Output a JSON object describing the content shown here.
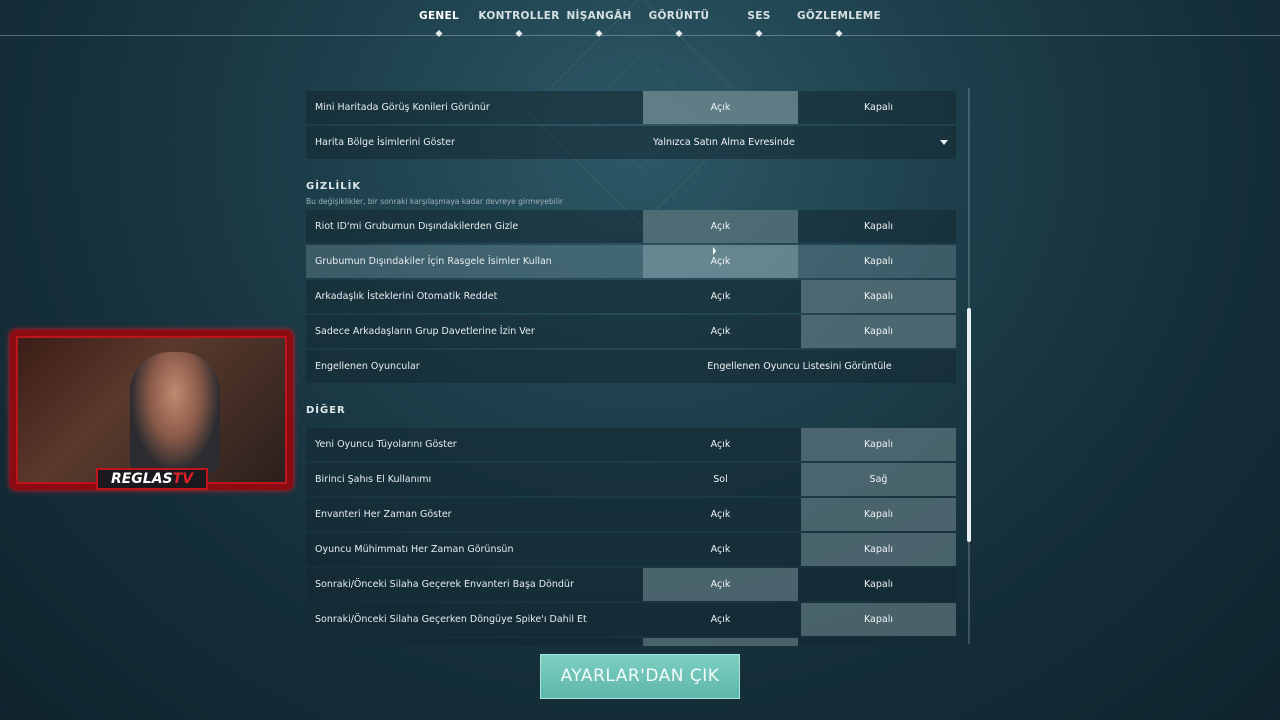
{
  "nav": {
    "tabs": [
      {
        "label": "GENEL",
        "active": true
      },
      {
        "label": "KONTROLLER",
        "active": false
      },
      {
        "label": "NİŞANGÂH",
        "active": false
      },
      {
        "label": "GÖRÜNTÜ",
        "active": false
      },
      {
        "label": "SES",
        "active": false
      },
      {
        "label": "GÖZLEMLEME",
        "active": false
      }
    ]
  },
  "map_rows": [
    {
      "label": "Mini Haritada Görüş Konileri Görünür",
      "opt_a": "Açık",
      "opt_b": "Kapalı",
      "selected": "a"
    },
    {
      "label": "Harita Bölge İsimlerini Göster",
      "dropdown_value": "Yalnızca Satın Alma Evresinde"
    }
  ],
  "privacy": {
    "title": "GİZLİLİK",
    "subtitle": "Bu değişiklikler, bir sonraki karşılaşmaya kadar devreye girmeyebilir",
    "rows": [
      {
        "label": "Riot ID'mi Grubumun Dışındakilerden Gizle",
        "opt_a": "Açık",
        "opt_b": "Kapalı",
        "selected": "a"
      },
      {
        "label": "Grubumun Dışındakiler İçin Rasgele İsimler Kullan",
        "opt_a": "Açık",
        "opt_b": "Kapalı",
        "selected": "a"
      },
      {
        "label": "Arkadaşlık İsteklerini Otomatik Reddet",
        "opt_a": "Açık",
        "opt_b": "Kapalı",
        "selected": "b"
      },
      {
        "label": "Sadece Arkadaşların Grup Davetlerine İzin Ver",
        "opt_a": "Açık",
        "opt_b": "Kapalı",
        "selected": "b"
      }
    ],
    "blocked_label": "Engellenen Oyuncular",
    "blocked_button": "Engellenen Oyuncu Listesini Görüntüle"
  },
  "other": {
    "title": "DİĞER",
    "rows": [
      {
        "label": "Yeni Oyuncu Tüyolarını Göster",
        "opt_a": "Açık",
        "opt_b": "Kapalı",
        "selected": "b"
      },
      {
        "label": "Birinci Şahıs El Kullanımı",
        "opt_a": "Sol",
        "opt_b": "Sağ",
        "selected": "b"
      },
      {
        "label": "Envanteri Her Zaman Göster",
        "opt_a": "Açık",
        "opt_b": "Kapalı",
        "selected": "b"
      },
      {
        "label": "Oyuncu Mühimmatı Her Zaman Görünsün",
        "opt_a": "Açık",
        "opt_b": "Kapalı",
        "selected": "b"
      },
      {
        "label": "Sonraki/Önceki Silaha Geçerek Envanteri Başa Döndür",
        "opt_a": "Açık",
        "opt_b": "Kapalı",
        "selected": "a"
      },
      {
        "label": "Sonraki/Önceki Silaha Geçerken Döngüye Spike'ı Dahil Et",
        "opt_a": "Açık",
        "opt_b": "Kapalı",
        "selected": "b"
      }
    ]
  },
  "exit_button": "AYARLAR'DAN ÇIK",
  "webcam": {
    "brand_a": "REGLAS",
    "brand_b": "TV"
  }
}
